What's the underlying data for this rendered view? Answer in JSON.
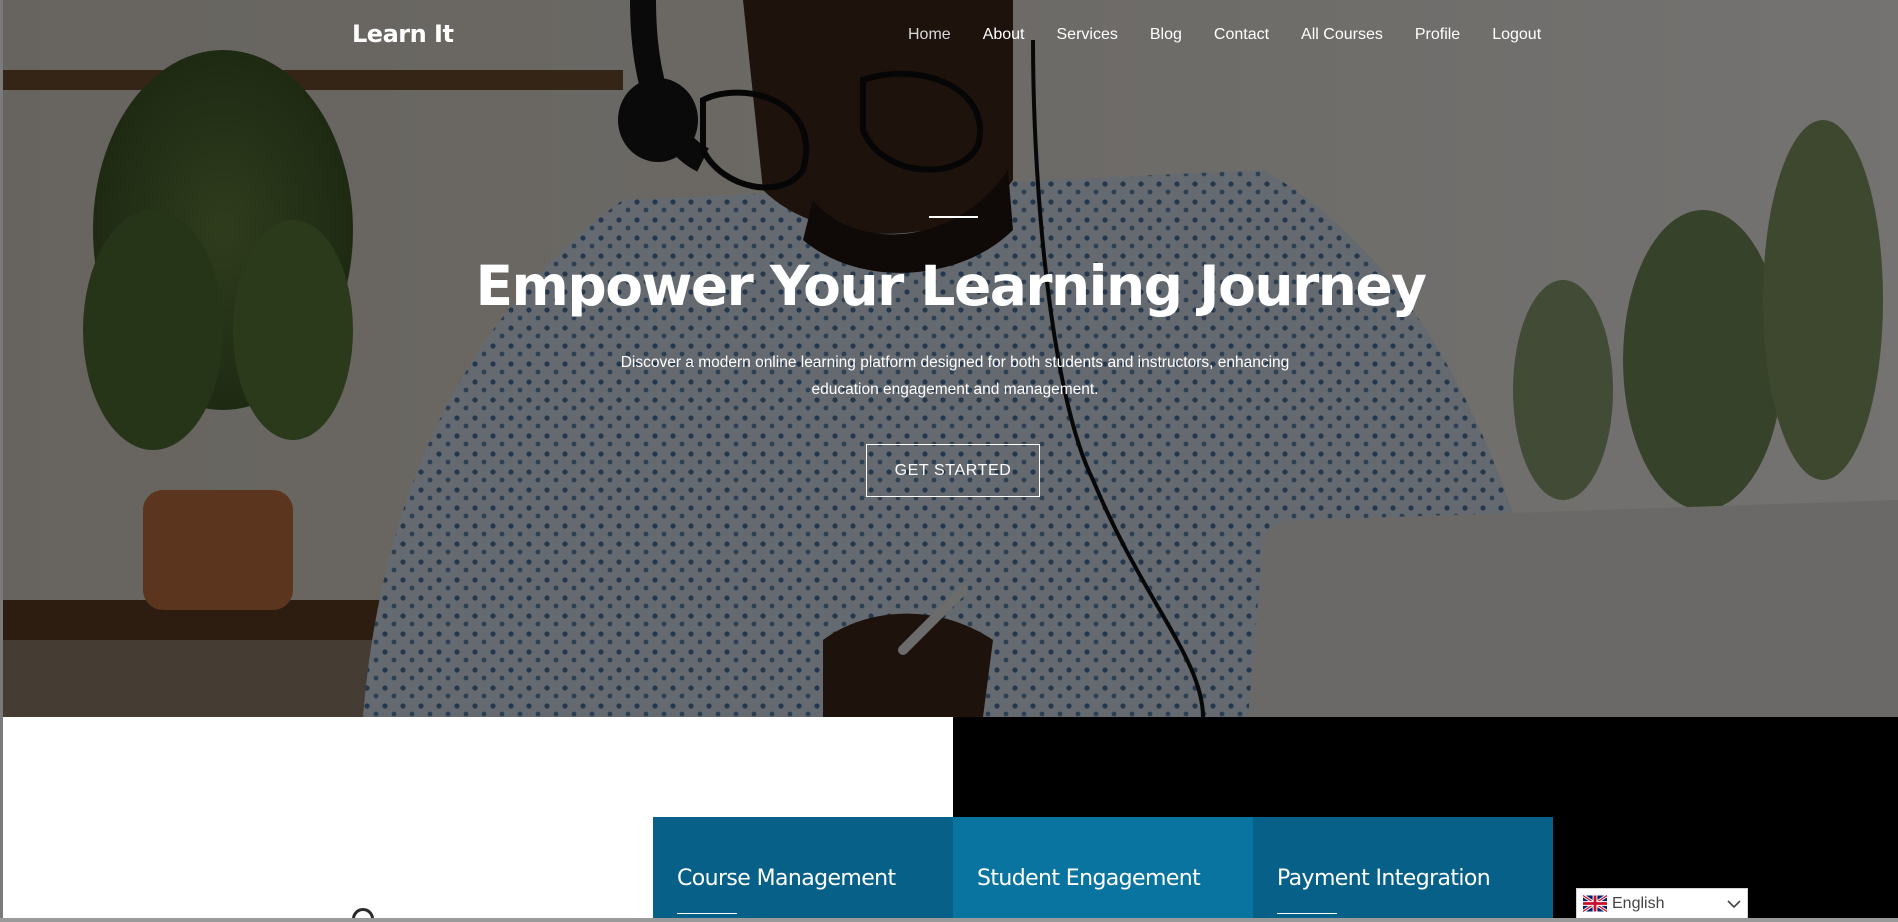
{
  "header": {
    "brand": "Learn It",
    "nav": [
      {
        "label": "Home",
        "active": true
      },
      {
        "label": "About"
      },
      {
        "label": "Services"
      },
      {
        "label": "Blog"
      },
      {
        "label": "Contact"
      },
      {
        "label": "All Courses"
      },
      {
        "label": "Profile"
      },
      {
        "label": "Logout"
      }
    ]
  },
  "hero": {
    "title": "Empower Your Learning Journey",
    "subtitle": "Discover a modern online learning platform designed for both students and instructors, enhancing education engagement and management.",
    "cta_label": "GET STARTED"
  },
  "features": [
    {
      "title": "Course Management"
    },
    {
      "title": "Student Engagement"
    },
    {
      "title": "Payment Integration"
    }
  ],
  "language_selector": {
    "selected": "English",
    "flag_icon": "uk-flag-icon",
    "chevron_icon": "chevron-down-icon"
  },
  "colors": {
    "card_dark": "#066088",
    "card_light": "#0a74a1",
    "overlay": "rgba(0,0,0,0.50)"
  }
}
